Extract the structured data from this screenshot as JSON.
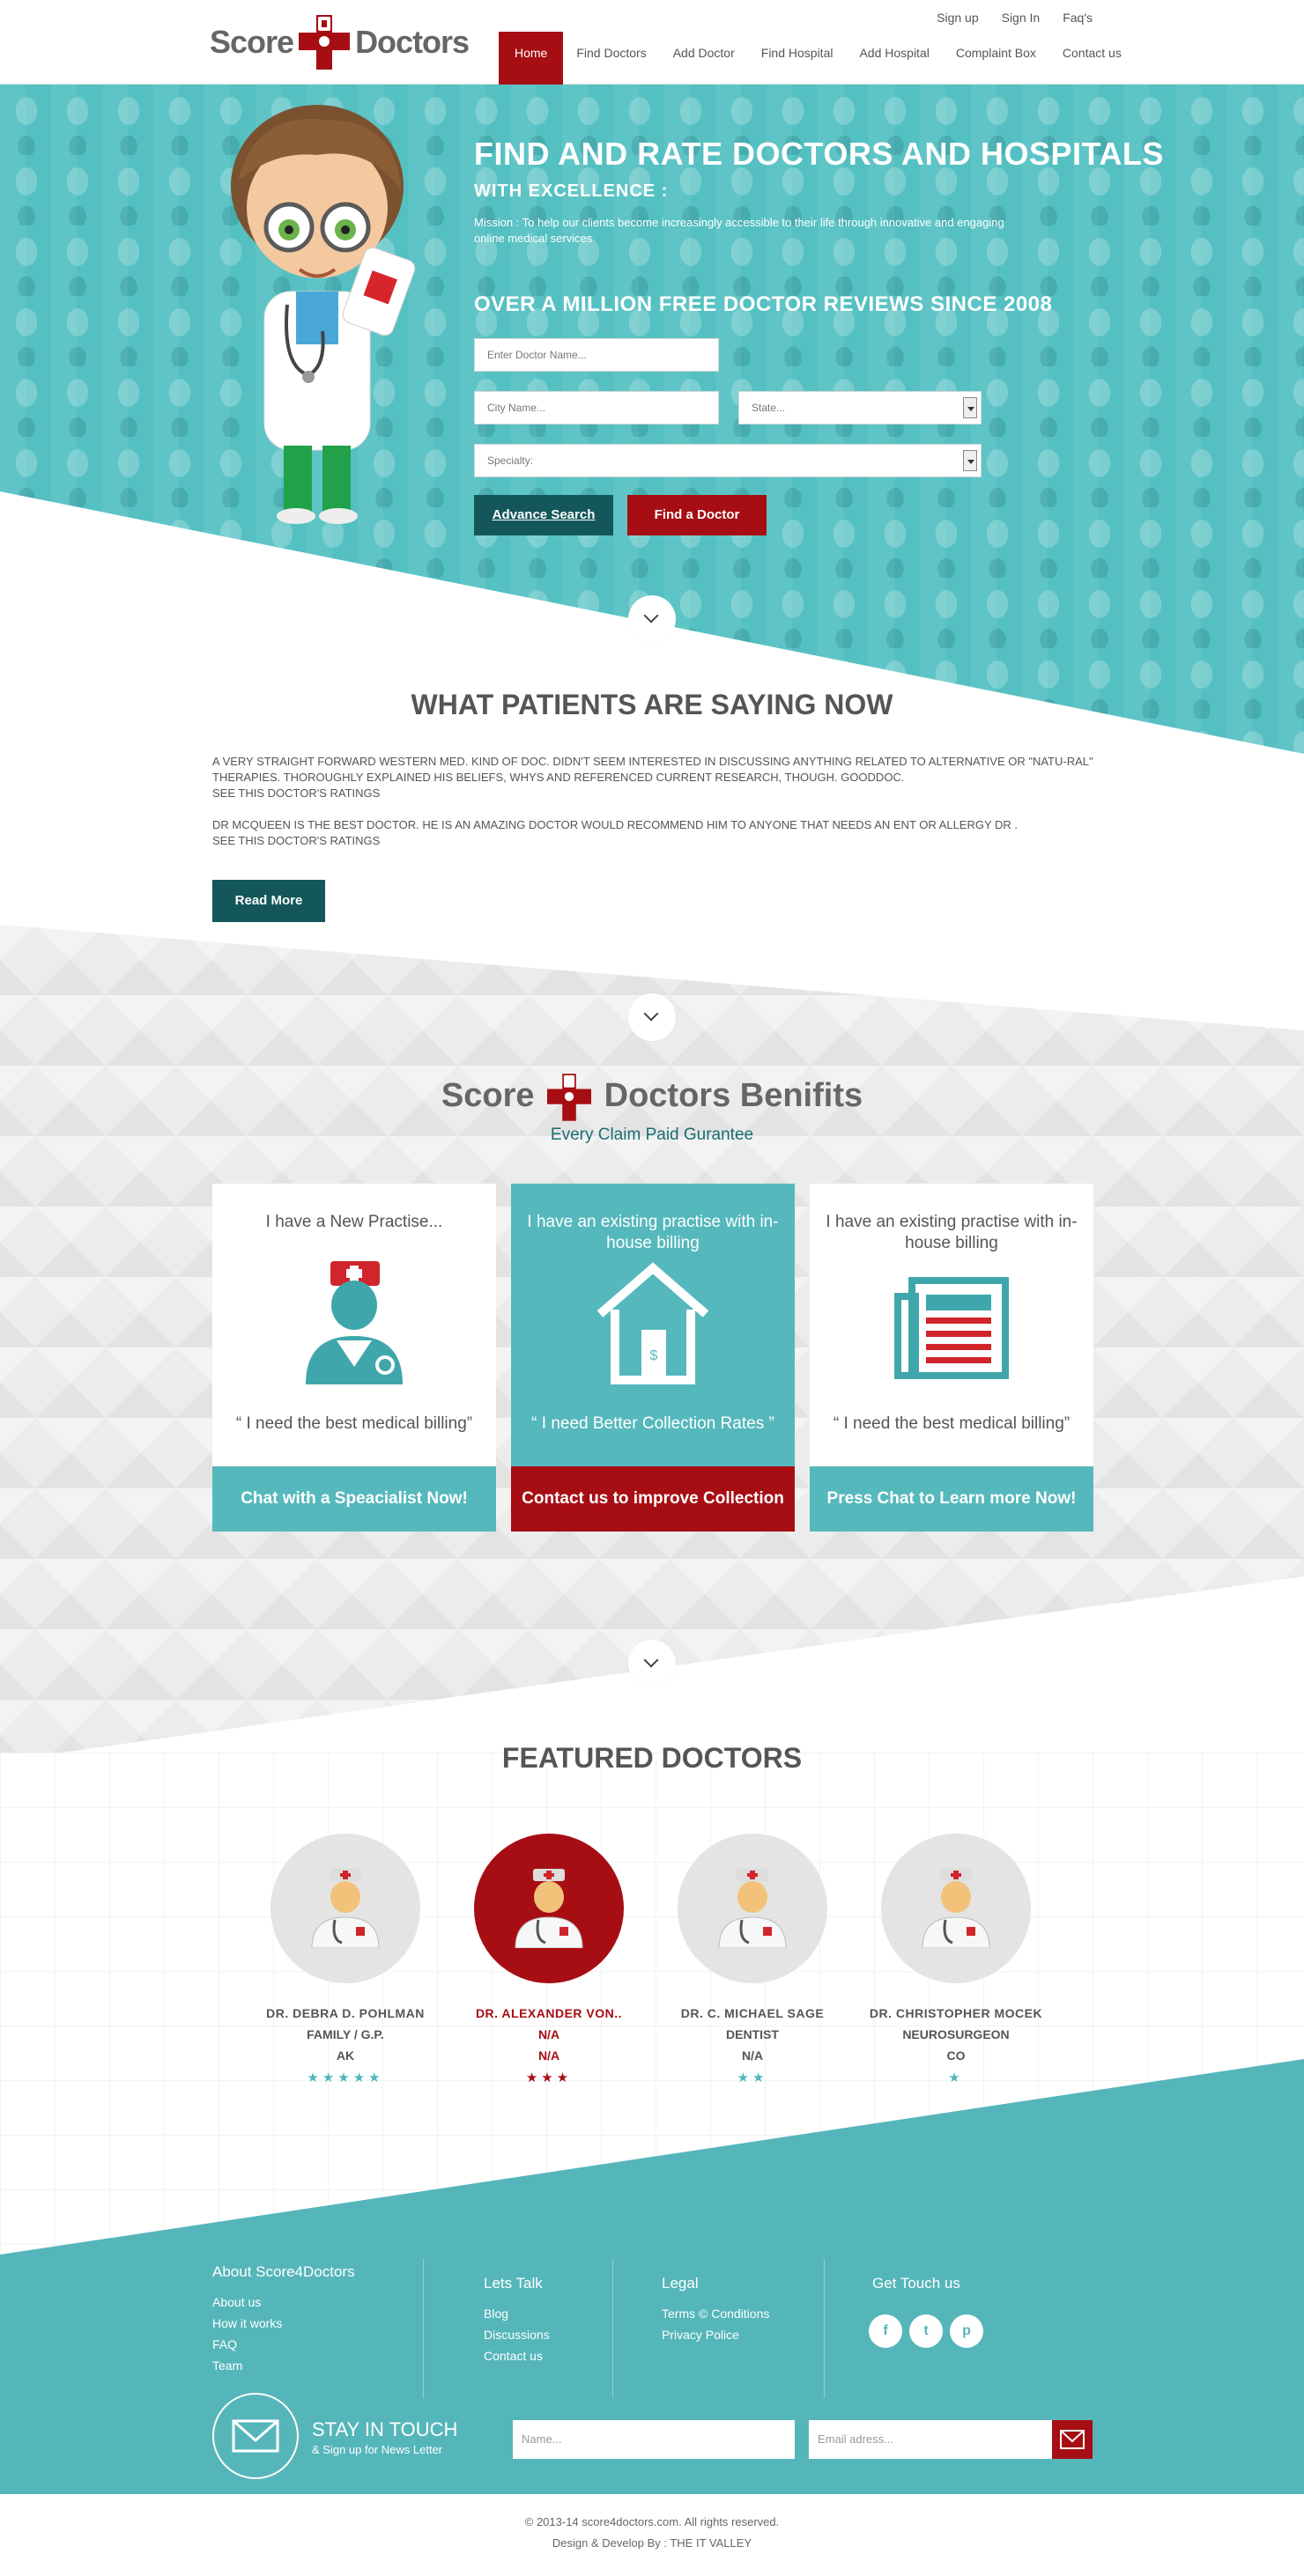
{
  "brand": {
    "word1": "Score",
    "word2": "Doctors",
    "accent": "#a60e13",
    "teal": "#55b8bc",
    "dark_teal": "#14575a"
  },
  "top_links": [
    "Sign up",
    "Sign In",
    "Faq's"
  ],
  "main_nav": [
    "Home",
    "Find Doctors",
    "Add Doctor",
    "Find Hospital",
    "Add Hospital",
    "Complaint Box",
    "Contact us"
  ],
  "hero": {
    "title": "FIND AND RATE DOCTORS AND HOSPITALS",
    "subtitle": "WITH EXCELLENCE :",
    "mission": "Mission :  To help our clients become increasingly accessible to their life through innovative and engaging online medical services",
    "reviews_heading": "OVER A MILLION FREE DOCTOR REVIEWS SINCE 2008",
    "doctor_placeholder": "Enter Doctor Name...",
    "city_placeholder": "City Name...",
    "state_placeholder": "State...",
    "specialty_placeholder": "Specialty:",
    "advance_search": "Advance Search",
    "find_doctor": "Find a Doctor"
  },
  "patients": {
    "title": "WHAT PATIENTS ARE SAYING NOW",
    "reviews": [
      {
        "text": "A VERY STRAIGHT FORWARD WESTERN MED. KIND OF DOC. DIDN'T SEEM INTERESTED IN DISCUSSING ANYTHING RELATED TO ALTERNATIVE OR \"NATU-RAL\" THERAPIES. THOROUGHLY EXPLAINED HIS BELIEFS, WHYS AND REFERENCED CURRENT RESEARCH, THOUGH. GOODDOC.",
        "link": "SEE THIS DOCTOR'S RATINGS"
      },
      {
        "text": "DR MCQUEEN IS THE BEST DOCTOR. HE IS AN AMAZING DOCTOR WOULD RECOMMEND HIM TO ANYONE THAT NEEDS AN ENT OR ALLERGY DR .",
        "link": "SEE THIS DOCTOR'S RATINGS"
      }
    ],
    "read_more": "Read More"
  },
  "benefits": {
    "logo_word1": "Score",
    "logo_word2": "Doctors Benifits",
    "subtitle": "Every Claim Paid Gurantee",
    "cards": [
      {
        "title": "I have a New Practise...",
        "quote": "“ I need the best medical billing”",
        "button": "Chat with a Speacialist Now!",
        "icon": "doctor-icon"
      },
      {
        "title": "I have an existing practise with in-house billing",
        "quote": "“ I need Better Collection Rates ”",
        "button": "Contact us to improve Collection",
        "icon": "house-icon"
      },
      {
        "title": "I have an existing practise with in-house billing",
        "quote": "“ I need the best medical billing”",
        "button": "Press Chat to Learn more Now!",
        "icon": "newspaper-icon"
      }
    ]
  },
  "featured": {
    "title": "FEATURED DOCTORS",
    "doctors": [
      {
        "name": "DR. DEBRA D. POHLMAN",
        "specialty": "FAMILY / G.P.",
        "location": "AK",
        "rating": 5,
        "stars": "★★★★★"
      },
      {
        "name": "DR. ALEXANDER VON..",
        "specialty": "N/A",
        "location": "N/A",
        "rating": 3,
        "stars": "★★★"
      },
      {
        "name": "DR. C. MICHAEL SAGE",
        "specialty": "DENTIST",
        "location": "N/A",
        "rating": 2,
        "stars": "★★"
      },
      {
        "name": "DR. CHRISTOPHER MOCEK",
        "specialty": "NEUROSURGEON",
        "location": "CO",
        "rating": 1,
        "stars": "★"
      }
    ]
  },
  "footer": {
    "about_title": "About  Score4Doctors",
    "about_links": [
      "About us",
      "How it works",
      "FAQ",
      "Team"
    ],
    "talk_title": "Lets Talk",
    "talk_links": [
      "Blog",
      "Discussions",
      "Contact us"
    ],
    "legal_title": "Legal",
    "legal_links": [
      "Terms © Conditions",
      "Privacy Police"
    ],
    "touch_title": "Get Touch us",
    "social": [
      {
        "icon": "facebook-icon",
        "glyph": "f"
      },
      {
        "icon": "twitter-icon",
        "glyph": "t"
      },
      {
        "icon": "pinterest-icon",
        "glyph": "p"
      }
    ],
    "stay_title": "STAY IN TOUCH",
    "stay_sub": "& Sign up for News Letter",
    "name_placeholder": "Name...",
    "email_placeholder": "Email adress...",
    "copyright": "© 2013-14 score4doctors.com. All rights reserved.",
    "credit": "Design & Develop By : THE IT VALLEY"
  }
}
